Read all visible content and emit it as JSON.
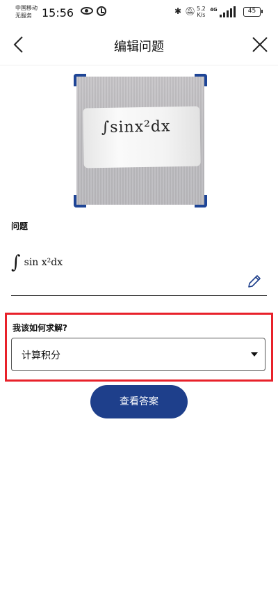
{
  "status_bar": {
    "carrier_line1": "中国移动",
    "carrier_line2": "无服务",
    "time": "15:56",
    "speed_value": "5.2",
    "speed_unit": "K/s",
    "network": "4G",
    "battery": "45"
  },
  "header": {
    "title": "编辑问题",
    "back_icon": "chevron-left-icon",
    "close_icon": "close-icon"
  },
  "photo": {
    "handwritten_text": "∫sinx²dx"
  },
  "question": {
    "label": "问题",
    "integral_sign": "∫",
    "formula": "sin x²dx"
  },
  "solve": {
    "label": "我该如何求解?",
    "selected_option": "计算积分"
  },
  "actions": {
    "view_answer": "查看答案"
  },
  "colors": {
    "primary": "#1e3f8b",
    "highlight": "#e8212a",
    "crop_corner": "#1e4596"
  }
}
